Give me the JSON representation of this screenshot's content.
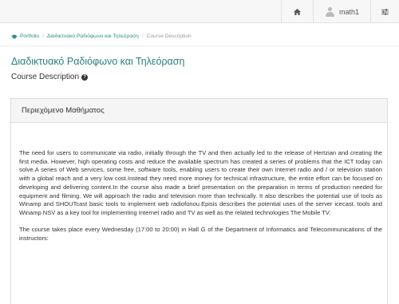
{
  "topbar": {
    "home_icon": "home-icon",
    "user_icon": "user-avatar-icon",
    "username": "math1",
    "settings_icon": "sliders-icon"
  },
  "breadcrumb": {
    "icon": "graduation-cap-icon",
    "items": [
      "Portfolio",
      "Διαδικτυακό Ραδιόφωνο και Τηλεόραση",
      "Course Description"
    ]
  },
  "page": {
    "title": "Διαδικτυακό Ραδιόφωνο και Τηλεόραση",
    "subtitle": "Course Description",
    "help_icon": "question-circle-icon"
  },
  "panel": {
    "heading": "Περιεχόμενο Μαθήματος",
    "paragraphs": [
      "The need for users to communicate via radio, initially through the TV and then actually led to the release of Hertzian and creating the first media. However, high operating costs and reduce the available spectrum has created a series of problems that the ICT today can solve.A series of Web services, some free, software tools, enabling users to create their own Internet radio and / or television station with a global reach and a very low cost.Instead they need more money for technical infrastructure, the entire effort can be focused on developing and delivering content.In the course also made a brief presentation on the preparation in terms of production needed for equipment and filming. We will approach the radio and television more than technically.  It also describes the potential use of tools as Winamp and SHOUTcast basic tools to implement web radiofonou.Episis describes the potential uses of the server icecast. tools and Winamp NSV as a key tool for implementing Internet radio and TV as well as the related technologies The Mobile TV.",
      "The course takes place every Wednesday (17:00 to 20:00) in Hall G of the Department of Informatics and Telecommunications of the instructors:"
    ]
  },
  "colors": {
    "accent": "#2a7d7d",
    "link": "#2a8c8c",
    "topbar_bg": "#f7f7f7",
    "panel_heading_bg": "#f5f5f5"
  }
}
